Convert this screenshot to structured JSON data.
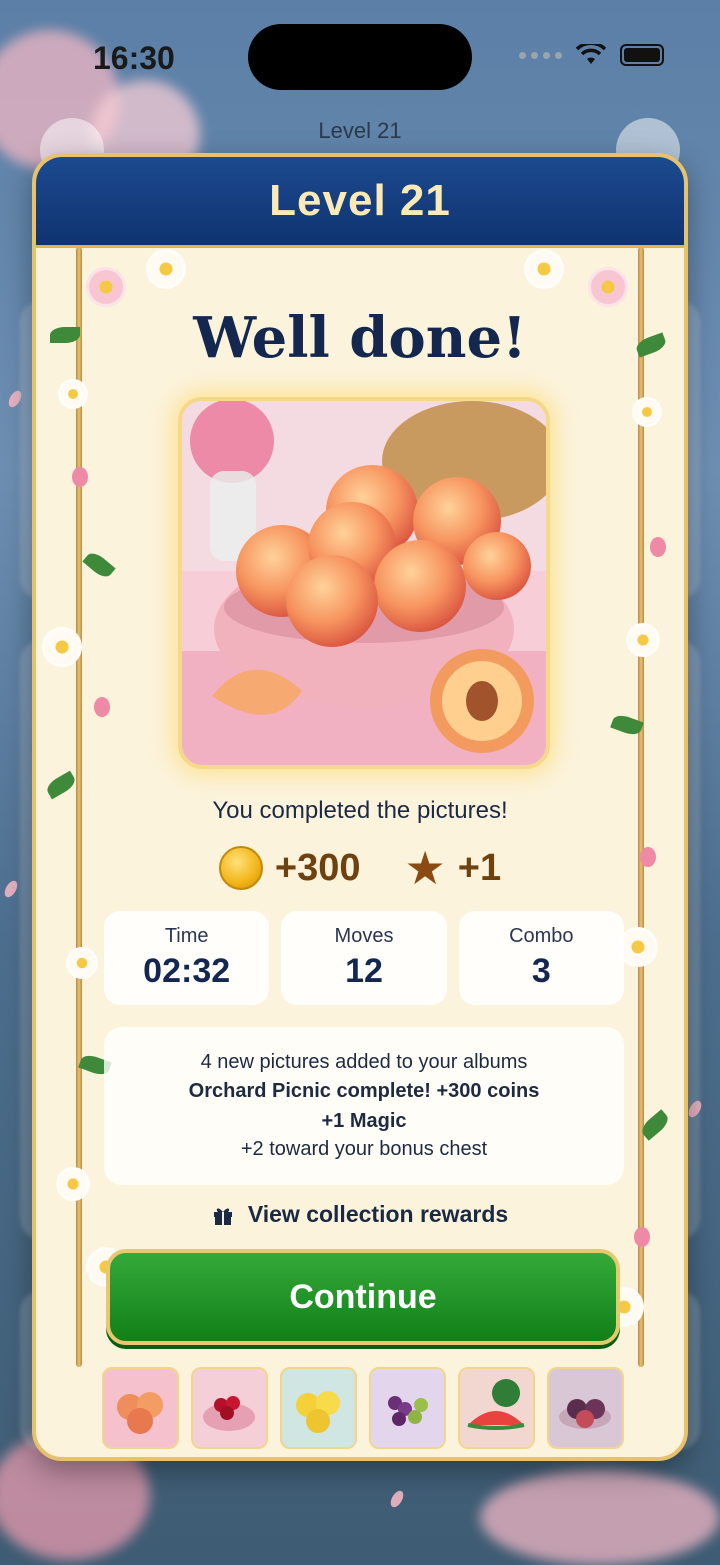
{
  "status_bar": {
    "time": "16:30"
  },
  "background": {
    "level_label": "Level 21"
  },
  "modal": {
    "title": "Level 21",
    "heading": "Well done!",
    "completed_text": "You completed the pictures!",
    "rewards": {
      "coins": "+300",
      "stars": "+1"
    },
    "stats": [
      {
        "label": "Time",
        "value": "02:32"
      },
      {
        "label": "Moves",
        "value": "12"
      },
      {
        "label": "Combo",
        "value": "3"
      }
    ],
    "info": {
      "line1": "4 new pictures added to your albums",
      "line2": "Orchard Picnic complete! +300 coins",
      "line3": "+1 Magic",
      "line4": "+2 toward your bonus chest"
    },
    "view_rewards_label": "View collection rewards",
    "continue_label": "Continue",
    "thumbnails": [
      "peaches",
      "cherries",
      "lemons",
      "grapes",
      "watermelon",
      "figs"
    ]
  },
  "colors": {
    "header_blue": "#1c4a8f",
    "continue_green": "#1f9426",
    "gold_border": "#e7c26a",
    "text_navy": "#14284f"
  }
}
